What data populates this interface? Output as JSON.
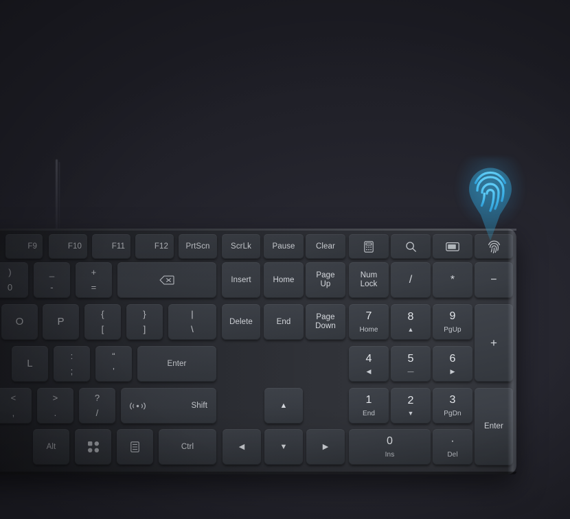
{
  "scene": {
    "title": "Wireless keyboard with fingerprint reader",
    "background_color": "#23232e",
    "keyboard_body_color": "#2c2e34",
    "key_color": "#3a3e45",
    "key_text_color": "#d7dadf",
    "accent_color": "#4cc3f0"
  },
  "marker": {
    "name": "fingerprint-pin",
    "icon": "fingerprint-icon",
    "shape": "teardrop-pin",
    "color_top": "#4ec7f2",
    "color_bottom": "#2a6f91",
    "points_to_key": "fingerprint-key"
  },
  "keyboard": {
    "rows": {
      "function_row": [
        {
          "name": "f9",
          "label": "F9"
        },
        {
          "name": "f10",
          "label": "F10"
        },
        {
          "name": "f11",
          "label": "F11"
        },
        {
          "name": "f12",
          "label": "F12"
        },
        {
          "name": "prtscn",
          "label": "PrtScn"
        },
        {
          "name": "scrlk",
          "label": "ScrLk"
        },
        {
          "name": "pause",
          "label": "Pause"
        },
        {
          "name": "clear",
          "label": "Clear"
        },
        {
          "name": "calculator",
          "label": "",
          "icon": "calculator-icon"
        },
        {
          "name": "search",
          "label": "",
          "icon": "search-icon"
        },
        {
          "name": "display",
          "label": "",
          "icon": "display-icon"
        },
        {
          "name": "fingerprint",
          "label": "",
          "icon": "fingerprint-icon"
        }
      ],
      "number_row": [
        {
          "name": "zero",
          "top": ")",
          "bottom": "0"
        },
        {
          "name": "minus",
          "top": "_",
          "bottom": "-"
        },
        {
          "name": "equals",
          "top": "+",
          "bottom": "="
        },
        {
          "name": "backspace",
          "label": "",
          "icon": "backspace-icon"
        },
        {
          "name": "insert",
          "label": "Insert"
        },
        {
          "name": "home",
          "label": "Home"
        },
        {
          "name": "page-up",
          "label": "Page\nUp"
        },
        {
          "name": "num-lock",
          "label": "Num\nLock"
        },
        {
          "name": "numpad-divide",
          "label": "/"
        },
        {
          "name": "numpad-multiply",
          "label": "*"
        },
        {
          "name": "numpad-minus",
          "label": "−"
        }
      ],
      "top_letter_row": [
        {
          "name": "letter-o",
          "label": "O"
        },
        {
          "name": "letter-p",
          "label": "P"
        },
        {
          "name": "bracket-left",
          "top": "{",
          "bottom": "["
        },
        {
          "name": "bracket-right",
          "top": "}",
          "bottom": "]"
        },
        {
          "name": "backslash",
          "top": "|",
          "bottom": "\\"
        },
        {
          "name": "delete",
          "label": "Delete"
        },
        {
          "name": "end",
          "label": "End"
        },
        {
          "name": "page-down",
          "label": "Page\nDown"
        },
        {
          "name": "numpad-7",
          "num": "7",
          "sub": "Home"
        },
        {
          "name": "numpad-8",
          "num": "8",
          "sub": "▲"
        },
        {
          "name": "numpad-9",
          "num": "9",
          "sub": "PgUp"
        },
        {
          "name": "numpad-plus",
          "label": "+"
        }
      ],
      "home_row": [
        {
          "name": "letter-l",
          "label": "L"
        },
        {
          "name": "semicolon",
          "top": ":",
          "bottom": ";"
        },
        {
          "name": "quote",
          "top": "“",
          "bottom": "’"
        },
        {
          "name": "enter",
          "label": "Enter"
        },
        {
          "name": "numpad-4",
          "num": "4",
          "sub": "◀"
        },
        {
          "name": "numpad-5",
          "num": "5",
          "sub": "—"
        },
        {
          "name": "numpad-6",
          "num": "6",
          "sub": "▶"
        }
      ],
      "bottom_letter_row": [
        {
          "name": "comma",
          "top": "<",
          "bottom": ","
        },
        {
          "name": "period",
          "top": ">",
          "bottom": "."
        },
        {
          "name": "slash",
          "top": "?",
          "bottom": "/"
        },
        {
          "name": "right-shift",
          "label": "Shift",
          "icon": "wireless-icon"
        },
        {
          "name": "arrow-up",
          "label": "▲"
        },
        {
          "name": "numpad-1",
          "num": "1",
          "sub": "End"
        },
        {
          "name": "numpad-2",
          "num": "2",
          "sub": "▼"
        },
        {
          "name": "numpad-3",
          "num": "3",
          "sub": "PgDn"
        },
        {
          "name": "numpad-enter",
          "label": "Enter"
        }
      ],
      "modifier_row": [
        {
          "name": "right-alt",
          "label": "Alt"
        },
        {
          "name": "start",
          "label": "",
          "icon": "windows-dots-icon"
        },
        {
          "name": "menu",
          "label": "",
          "icon": "menu-list-icon"
        },
        {
          "name": "right-ctrl",
          "label": "Ctrl"
        },
        {
          "name": "arrow-left",
          "label": "◀"
        },
        {
          "name": "arrow-down",
          "label": "▼"
        },
        {
          "name": "arrow-right",
          "label": "▶"
        },
        {
          "name": "numpad-0",
          "num": "0",
          "sub": "Ins"
        },
        {
          "name": "numpad-decimal",
          "num": "·",
          "sub": "Del"
        }
      ]
    }
  }
}
